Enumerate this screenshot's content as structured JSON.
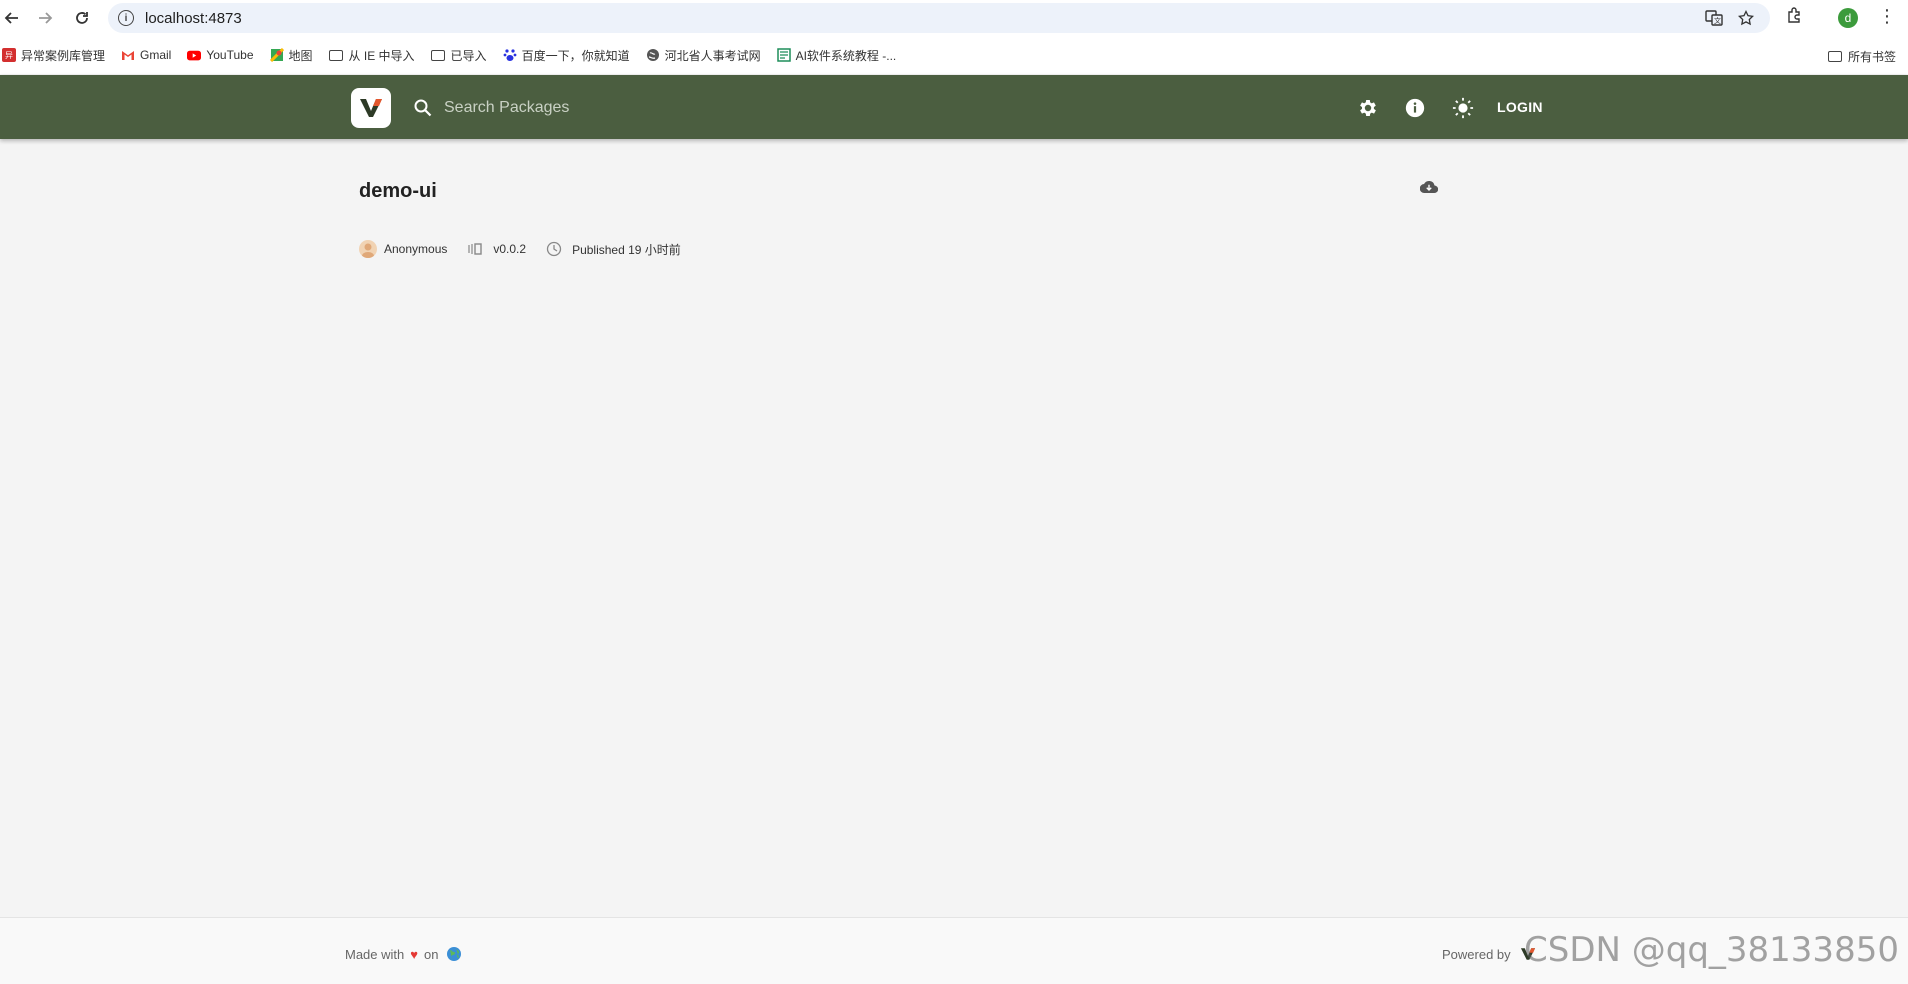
{
  "browser": {
    "url": "localhost:4873",
    "profile_initial": "d",
    "bookmarks": [
      {
        "label": "异常案例库管理",
        "icon": "red-logo-icon"
      },
      {
        "label": "Gmail",
        "icon": "gmail-icon"
      },
      {
        "label": "YouTube",
        "icon": "youtube-icon"
      },
      {
        "label": "地图",
        "icon": "maps-icon"
      },
      {
        "label": "从 IE 中导入",
        "icon": "folder-icon"
      },
      {
        "label": "已导入",
        "icon": "folder-icon"
      },
      {
        "label": "百度一下，你就知道",
        "icon": "baidu-icon"
      },
      {
        "label": "河北省人事考试网",
        "icon": "globe-icon"
      },
      {
        "label": "AI软件系统教程 -...",
        "icon": "green-doc-icon"
      }
    ],
    "all_bookmarks_label": "所有书签"
  },
  "header": {
    "search_placeholder": "Search Packages",
    "login_label": "LOGIN",
    "bg_color": "#4b5e40"
  },
  "package": {
    "name": "demo-ui",
    "author": "Anonymous",
    "version": "v0.0.2",
    "published": "Published 19 小时前"
  },
  "footer": {
    "made_with": "Made with",
    "on": "on",
    "powered_by": "Powered by"
  },
  "watermark": "CSDN @qq_38133850"
}
